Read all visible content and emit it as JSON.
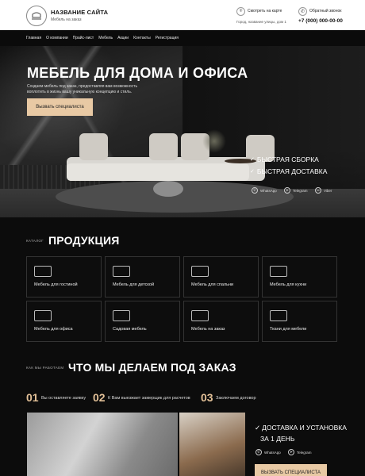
{
  "header": {
    "site_name": "НАЗВАНИЕ САЙТА",
    "site_sub": "Мебель на заказ",
    "map_link": "Смотреть на карте",
    "address": "Город, название улицы, дом 1",
    "call_link": "Обратный звонок",
    "phone": "+7 (000) 000-00-00"
  },
  "nav": [
    "Главная",
    "О компании",
    "Прайс-лист",
    "Мебель",
    "Акции",
    "Контакты",
    "Регистрация"
  ],
  "hero": {
    "title": "МЕБЕЛЬ ДЛЯ ДОМА И ОФИСА",
    "text": "Создаем мебель под заказ, предоставляя вам возможность воплотить в жизнь вашу уникальную концепцию и стиль.",
    "button": "Вызвать специалиста",
    "features": [
      "БЫСТРАЯ СБОРКА",
      "БЫСТРАЯ ДОСТАВКА"
    ],
    "social": [
      "WhatsApp",
      "Telegram",
      "Viber"
    ]
  },
  "products": {
    "label": "КАТАЛОГ",
    "title": "ПРОДУКЦИЯ",
    "items": [
      {
        "label": "Мебель для гостиной",
        "icon": "sofa-icon"
      },
      {
        "label": "Мебель для детской",
        "icon": "crib-icon"
      },
      {
        "label": "Мебель для спальни",
        "icon": "bed-icon"
      },
      {
        "label": "Мебель для кухни",
        "icon": "chairs-icon"
      },
      {
        "label": "Мебель для офиса",
        "icon": "office-desk-icon"
      },
      {
        "label": "Садовая мебель",
        "icon": "garden-chair-icon"
      },
      {
        "label": "Мебель на заказ",
        "icon": "cabinet-icon"
      },
      {
        "label": "Ткани для мебели",
        "icon": "fabric-icon"
      }
    ]
  },
  "process": {
    "label": "КАК МЫ РАБОТАЕМ",
    "title": "ЧТО МЫ ДЕЛАЕМ ПОД ЗАКАЗ",
    "steps": [
      {
        "num": "01",
        "text": "Вы оставляете заявку"
      },
      {
        "num": "02",
        "text": "К Вам выезжает замерщик для расчетов"
      },
      {
        "num": "03",
        "text": "Заключаем договор"
      }
    ]
  },
  "delivery": {
    "title_line1": "ДОСТАВКА И УСТАНОВКА",
    "title_line2": "ЗА 1 ДЕНЬ",
    "social": [
      "WhatsApp",
      "Telegram"
    ],
    "button": "ВЫЗВАТЬ СПЕЦИАЛИСТА"
  },
  "colors": {
    "accent": "#e8c9a4",
    "step_num": "#e3c198",
    "background": "#0c0c0c"
  }
}
